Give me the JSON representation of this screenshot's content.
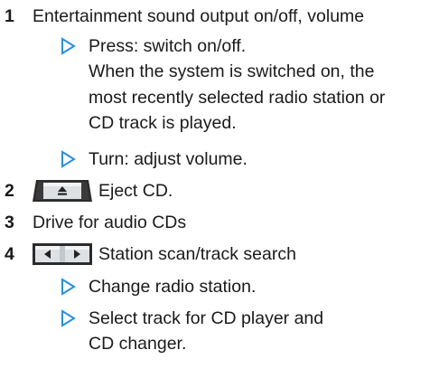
{
  "items": [
    {
      "number": "1",
      "text": "Entertainment sound output on/off, volume",
      "bullets": [
        {
          "lines": [
            "Press: switch on/off.",
            "When the system is switched on, the",
            "most recently selected radio station or",
            "CD track is played."
          ]
        },
        {
          "lines": [
            "Turn: adjust volume."
          ]
        }
      ]
    },
    {
      "number": "2",
      "icon": "eject-button-icon",
      "text": "Eject CD."
    },
    {
      "number": "3",
      "text": "Drive for audio CDs"
    },
    {
      "number": "4",
      "icon": "seek-button-icon",
      "text": "Station scan/track search",
      "bullets": [
        {
          "lines": [
            "Change radio station."
          ]
        },
        {
          "lines": [
            "Select track for CD player and",
            "CD changer."
          ]
        }
      ]
    }
  ],
  "colors": {
    "accent": "#2a8fd6",
    "text": "#1a1a1a",
    "button_dark": "#2b2b2b",
    "button_light": "#d9dde0"
  }
}
